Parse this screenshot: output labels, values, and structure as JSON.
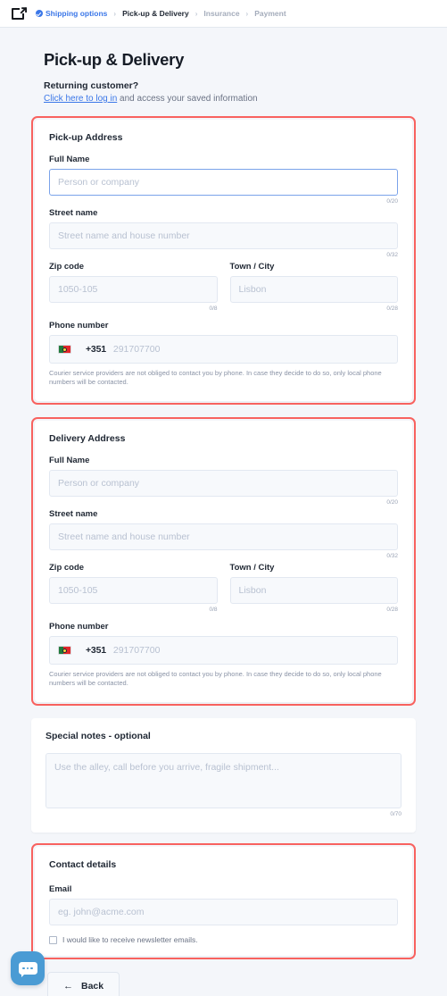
{
  "header": {
    "logo_icon": "external-link-square-icon",
    "breadcrumbs": [
      {
        "label": "Shipping options",
        "state": "done",
        "icon": "check-circle-icon"
      },
      {
        "label": "Pick-up & Delivery",
        "state": "current"
      },
      {
        "label": "Insurance",
        "state": "future"
      },
      {
        "label": "Payment",
        "state": "future"
      }
    ],
    "separator": "›"
  },
  "main": {
    "page_title": "Pick-up & Delivery",
    "returning_title": "Returning customer?",
    "login_link": "Click here to log in",
    "login_rest": " and access your saved information"
  },
  "pickup": {
    "title": "Pick-up Address",
    "full_name": {
      "label": "Full Name",
      "placeholder": "Person or company",
      "value": "",
      "counter": "0/20"
    },
    "street": {
      "label": "Street name",
      "placeholder": "Street name and house number",
      "value": "",
      "counter": "0/32"
    },
    "zip": {
      "label": "Zip code",
      "placeholder": "1050-105",
      "value": "",
      "counter": "0/8"
    },
    "city": {
      "label": "Town / City",
      "placeholder": "Lisbon",
      "value": "",
      "counter": "0/28"
    },
    "phone": {
      "label": "Phone number",
      "flag": "portugal-flag-icon",
      "dial_code": "+351",
      "placeholder": "291707700",
      "value": ""
    },
    "hint": "Courier service providers are not obliged to contact you by phone. In case they decide to do so, only local phone numbers will be contacted."
  },
  "delivery": {
    "title": "Delivery Address",
    "full_name": {
      "label": "Full Name",
      "placeholder": "Person or company",
      "value": "",
      "counter": "0/20"
    },
    "street": {
      "label": "Street name",
      "placeholder": "Street name and house number",
      "value": "",
      "counter": "0/32"
    },
    "zip": {
      "label": "Zip code",
      "placeholder": "1050-105",
      "value": "",
      "counter": "0/8"
    },
    "city": {
      "label": "Town / City",
      "placeholder": "Lisbon",
      "value": "",
      "counter": "0/28"
    },
    "phone": {
      "label": "Phone number",
      "flag": "portugal-flag-icon",
      "dial_code": "+351",
      "placeholder": "291707700",
      "value": ""
    },
    "hint": "Courier service providers are not obliged to contact you by phone. In case they decide to do so, only local phone numbers will be contacted."
  },
  "notes": {
    "title": "Special notes - optional",
    "placeholder": "Use the alley, call before you arrive, fragile shipment...",
    "value": "",
    "counter": "0/70"
  },
  "contact": {
    "title": "Contact details",
    "email": {
      "label": "Email",
      "placeholder": "eg. john@acme.com",
      "value": ""
    },
    "newsletter_label": "I would like to receive newsletter emails.",
    "newsletter_checked": false
  },
  "footer": {
    "back_label": "Back",
    "back_arrow": "←"
  },
  "chat": {
    "icon": "chat-bubble-icon"
  },
  "colors": {
    "accent_blue": "#3b77e8",
    "highlight_red": "#f8625f",
    "page_bg": "#f4f6fa",
    "chat_blue": "#4a9bd4"
  }
}
